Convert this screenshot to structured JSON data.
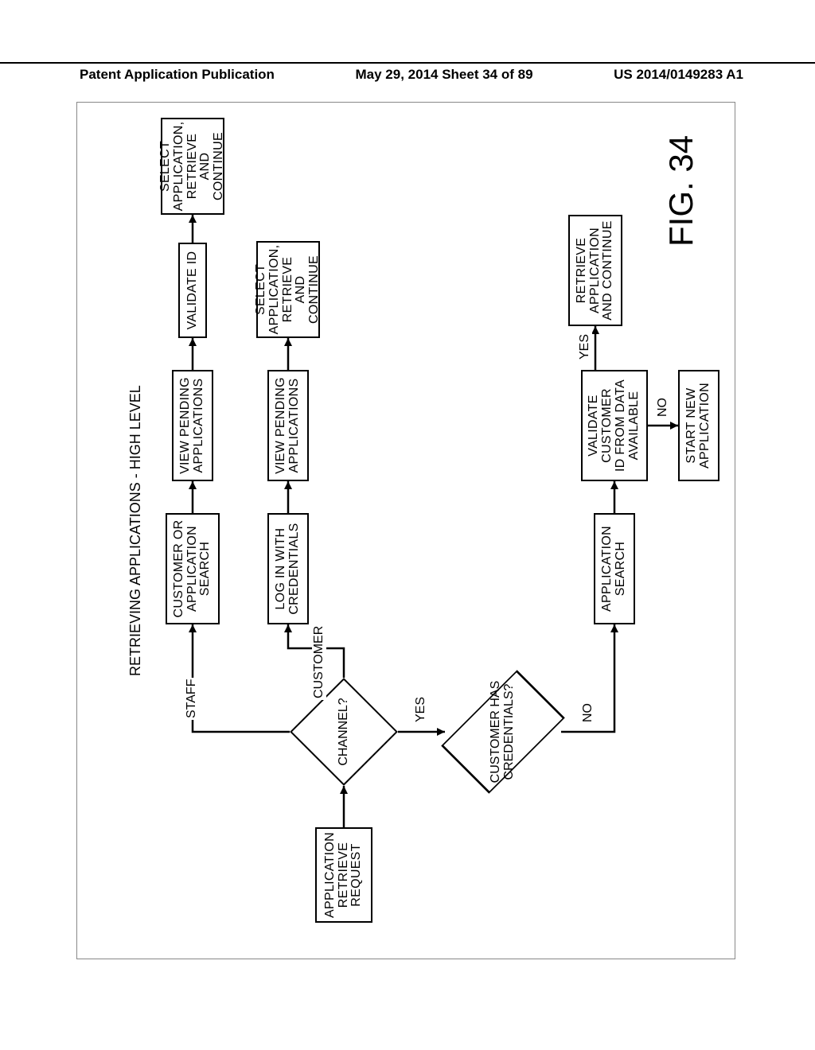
{
  "header": {
    "left": "Patent Application Publication",
    "center": "May 29, 2014  Sheet 34 of 89",
    "right": "US 2014/0149283 A1"
  },
  "title": "RETRIEVING APPLICATIONS - HIGH LEVEL",
  "figno": "FIG. 34",
  "nodes": {
    "app_retrieve_request": "APPLICATION\nRETRIEVE\nREQUEST",
    "channel": "CHANNEL?",
    "customer_has_creds": "CUSTOMER HAS\nCREDENTIALS?",
    "customer_or_app_search": "CUSTOMER OR\nAPPLICATION\nSEARCH",
    "view_pending_1": "VIEW PENDING\nAPPLICATIONS",
    "validate_id": "VALIDATE ID",
    "select_app_1": "SELECT\nAPPLICATION,\nRETRIEVE AND\nCONTINUE",
    "login_creds": "LOG IN WITH\nCREDENTIALS",
    "view_pending_2": "VIEW PENDING\nAPPLICATIONS",
    "select_app_2": "SELECT\nAPPLICATION,\nRETRIEVE AND\nCONTINUE",
    "application_search": "APPLICATION\nSEARCH",
    "validate_customer_id": "VALIDATE\nCUSTOMER\nID FROM DATA\nAVAILABLE",
    "retrieve_app_continue": "RETRIEVE\nAPPLICATION\nAND CONTINUE",
    "start_new_app": "START NEW\nAPPLICATION"
  },
  "edges": {
    "staff": "STAFF",
    "customer": "CUSTOMER",
    "yes": "YES",
    "no": "NO"
  }
}
